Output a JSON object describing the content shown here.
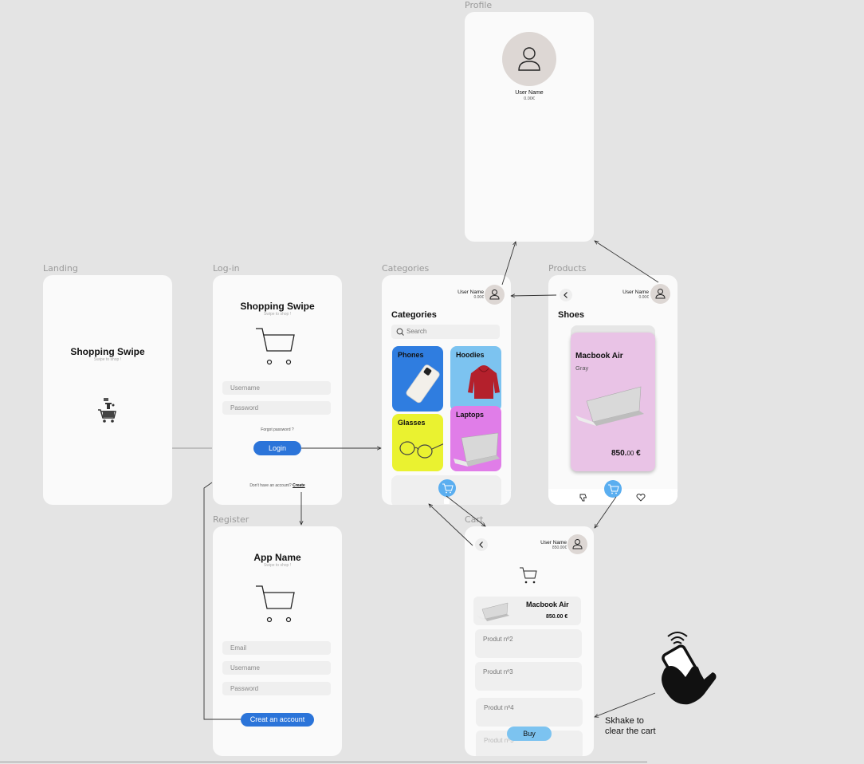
{
  "labels": {
    "profile": "Profile",
    "landing": "Landing",
    "login": "Log-in",
    "categories": "Categories",
    "products": "Products",
    "register": "Register",
    "cart": "Cart"
  },
  "user": {
    "name": "User Name",
    "balance": "0.00€",
    "cart_balance": "850.00€"
  },
  "landing": {
    "title": "Shopping Swipe",
    "subtitle": "Swipe to shop !"
  },
  "login": {
    "title": "Shopping Swipe",
    "subtitle": "Swipe to shop !",
    "username_placeholder": "Username",
    "password_placeholder": "Password",
    "forgot": "Forgot password ?",
    "login_button": "Login",
    "no_account": "Don't have an account?",
    "create_link": "Create"
  },
  "categories": {
    "heading": "Categories",
    "search_placeholder": "Search",
    "items": [
      "Phones",
      "Hoodies",
      "Glasses",
      "Laptops"
    ]
  },
  "products": {
    "heading": "Shoes",
    "card_title": "Macbook Air",
    "card_subtitle": "Gray",
    "price_main": "850.",
    "price_cents": "00",
    "price_currency": " €"
  },
  "register": {
    "title": "App Name",
    "subtitle": "Swipe to shop !",
    "email_placeholder": "Email",
    "username_placeholder": "Username",
    "password_placeholder": "Password",
    "create_button": "Creat an account"
  },
  "cart": {
    "item_name": "Macbook Air",
    "item_price": "850.00 €",
    "products": [
      "Produt nº2",
      "Produt nº3",
      "Produt nº4",
      "Produt nº5"
    ],
    "buy_button": "Buy"
  },
  "annotation": {
    "line1": "Skhake to",
    "line2": "clear the cart"
  },
  "icons": [
    "cart-icon",
    "user-icon",
    "search-icon",
    "back-icon",
    "dislike-icon",
    "heart-icon",
    "shake-phone-icon"
  ],
  "colors": {
    "accent": "#2b74d9",
    "cart_button": "#5aaef0",
    "phones": "#2f7de0",
    "hoodies": "#7cc3f0",
    "glasses": "#eaf230",
    "laptops": "#e07de8",
    "product_card": "#e9c3e6"
  }
}
